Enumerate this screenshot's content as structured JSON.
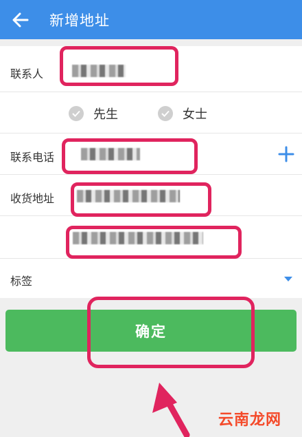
{
  "header": {
    "title": "新增地址",
    "back_icon": "arrow-left-icon"
  },
  "form": {
    "contact_name": {
      "label": "联系人",
      "value": ""
    },
    "gender": {
      "options": [
        "先生",
        "女士"
      ],
      "selected": null
    },
    "phone": {
      "label": "联系电话",
      "value": "",
      "add_icon": "plus-icon"
    },
    "address": {
      "label": "收货地址",
      "value": "",
      "detail_value": ""
    },
    "tag": {
      "label": "标签",
      "value": "",
      "dropdown_icon": "caret-down-icon"
    }
  },
  "actions": {
    "confirm_label": "确定"
  },
  "watermark": {
    "text": "云南龙网"
  },
  "colors": {
    "primary": "#3d8ee8",
    "confirm": "#4cba5e",
    "highlight": "#e0245e",
    "watermark": "#f44a2a"
  }
}
